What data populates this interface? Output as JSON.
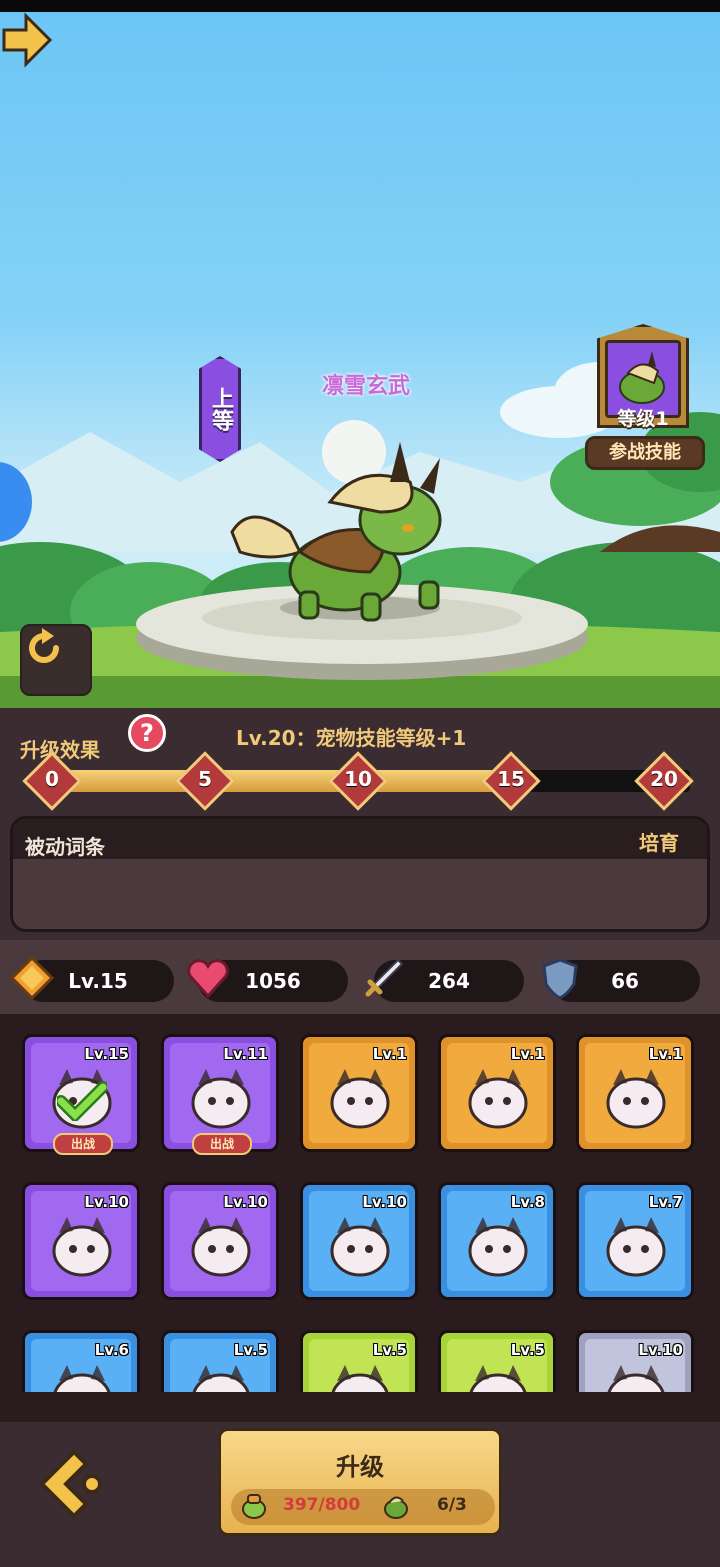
{
  "pet": {
    "name": "凛雪玄武",
    "rank": "上等"
  },
  "skill_card": {
    "level": "等级1",
    "button": "参战技能"
  },
  "upgrade_effect": {
    "label": "升级效果",
    "help": "?",
    "text": "Lv.20：宠物技能等级+1",
    "milestones": [
      "0",
      "5",
      "10",
      "15",
      "20"
    ],
    "progress_fraction": 0.75
  },
  "passive": {
    "label": "被动词条",
    "nurture": "培育"
  },
  "stats": {
    "level": "Lv.15",
    "hp": "1056",
    "attack": "264",
    "defense": "66"
  },
  "pets": [
    {
      "lv": "Lv.15",
      "rarity": "purple",
      "tag": "出战",
      "checked": true
    },
    {
      "lv": "Lv.11",
      "rarity": "purple",
      "tag": "出战",
      "checked": false
    },
    {
      "lv": "Lv.1",
      "rarity": "orange"
    },
    {
      "lv": "Lv.1",
      "rarity": "orange"
    },
    {
      "lv": "Lv.1",
      "rarity": "orange"
    },
    {
      "lv": "Lv.10",
      "rarity": "purple"
    },
    {
      "lv": "Lv.10",
      "rarity": "purple"
    },
    {
      "lv": "Lv.10",
      "rarity": "blue"
    },
    {
      "lv": "Lv.8",
      "rarity": "blue"
    },
    {
      "lv": "Lv.7",
      "rarity": "blue"
    },
    {
      "lv": "Lv.6",
      "rarity": "blue"
    },
    {
      "lv": "Lv.5",
      "rarity": "blue"
    },
    {
      "lv": "Lv.5",
      "rarity": "green"
    },
    {
      "lv": "Lv.5",
      "rarity": "green"
    },
    {
      "lv": "Lv.10",
      "rarity": "gray"
    }
  ],
  "bottom": {
    "upgrade": "升级",
    "cost_food": "397/800",
    "cost_pets": "6/3"
  },
  "colors": {
    "gold": "#f1c97a",
    "panel": "#3a2c30",
    "purple_rarity": "#8a4fe0",
    "orange_rarity": "#e0922a",
    "blue_rarity": "#3a8fe0",
    "green_rarity": "#a8d43a"
  }
}
